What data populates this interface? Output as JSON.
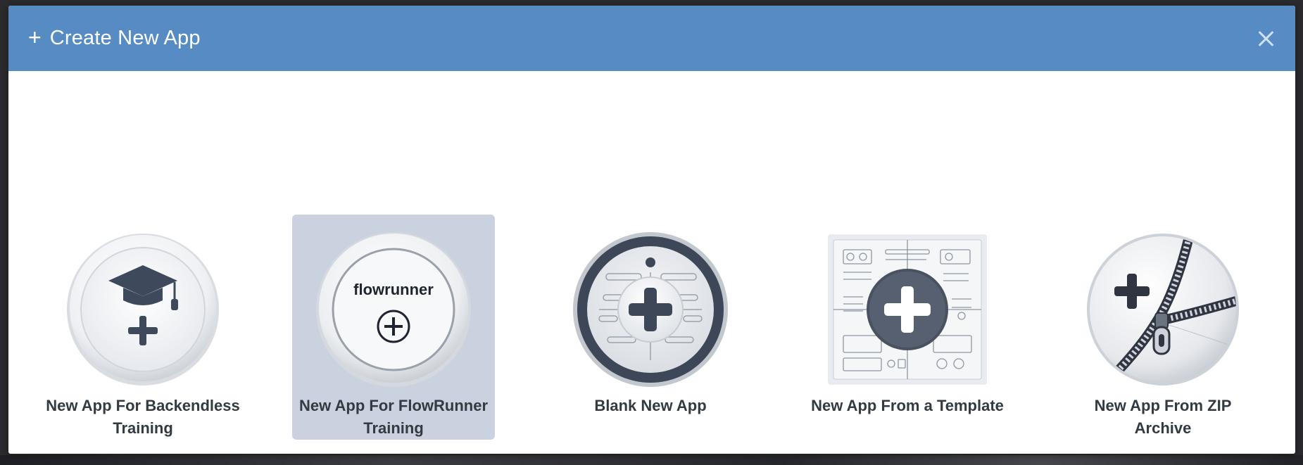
{
  "dialog": {
    "title": "Create New App",
    "title_icon": "plus-icon",
    "close_icon": "close-icon",
    "header_color": "#568cc3"
  },
  "options": [
    {
      "id": "backendless-training",
      "label": "New App For Backendless Training",
      "icon": "graduation-cap-plus-icon",
      "selected": false
    },
    {
      "id": "flowrunner-training",
      "label": "New App For FlowRunner Training",
      "icon": "flowrunner-logo-icon",
      "logo_text": "flowrunner",
      "selected": true
    },
    {
      "id": "blank",
      "label": "Blank New App",
      "icon": "blank-app-plus-icon",
      "selected": false
    },
    {
      "id": "template",
      "label": "New App From a Template",
      "icon": "template-plus-icon",
      "selected": false
    },
    {
      "id": "zip",
      "label": "New App From ZIP Archive",
      "icon": "zip-archive-icon",
      "selected": false
    }
  ],
  "colors": {
    "selected_bg": "#c9d2de",
    "label_text": "#333a42"
  }
}
